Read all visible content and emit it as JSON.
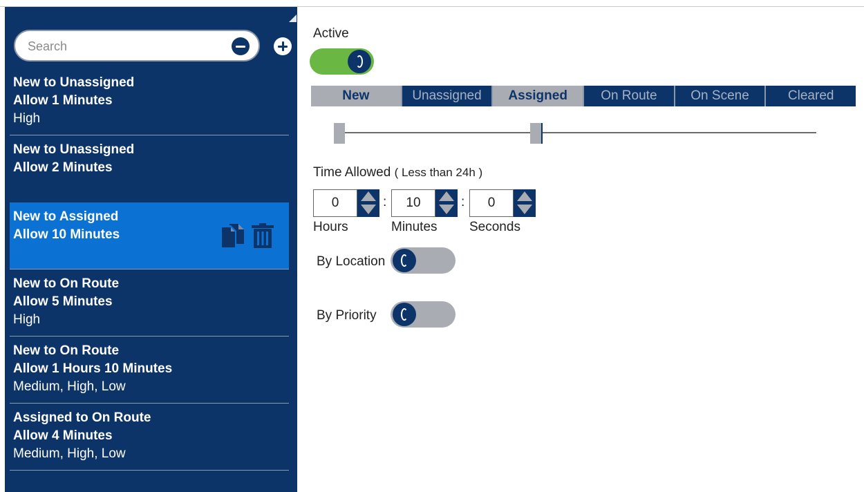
{
  "search": {
    "placeholder": "Search"
  },
  "list": {
    "items": [
      {
        "line1": "New to Unassigned",
        "line2": "Allow 1 Minutes",
        "line3": "High"
      },
      {
        "line1": "New to Unassigned",
        "line2": "Allow 2 Minutes",
        "line3": ""
      },
      {
        "line1": "New to Assigned",
        "line2": "Allow 10 Minutes",
        "line3": ""
      },
      {
        "line1": "New to On Route",
        "line2": "Allow 5 Minutes",
        "line3": "High"
      },
      {
        "line1": "New to On Route",
        "line2": "Allow 1 Hours 10 Minutes",
        "line3": "Medium, High, Low"
      },
      {
        "line1": "Assigned to On Route",
        "line2": "Allow 4 Minutes",
        "line3": "Medium, High, Low"
      }
    ],
    "selected_index": 2
  },
  "main": {
    "active_label": "Active",
    "active_on": true,
    "tabs": [
      "New",
      "Unassigned",
      "Assigned",
      "On Route",
      "On Scene",
      "Cleared"
    ],
    "selected_tabs": [
      "New",
      "Assigned"
    ],
    "time_allowed_label": "Time Allowed",
    "time_allowed_hint": "( Less than 24h )",
    "hours_value": "0",
    "minutes_value": "10",
    "seconds_value": "0",
    "colon": ":",
    "hours_label": "Hours",
    "minutes_label": "Minutes",
    "seconds_label": "Seconds",
    "by_location_label": "By Location",
    "by_location_on": false,
    "by_priority_label": "By Priority",
    "by_priority_on": false
  },
  "colors": {
    "navy": "#0d3469",
    "selected_blue": "#0b71d2",
    "toggle_green": "#6ab744",
    "gray": "#a9adb3"
  }
}
